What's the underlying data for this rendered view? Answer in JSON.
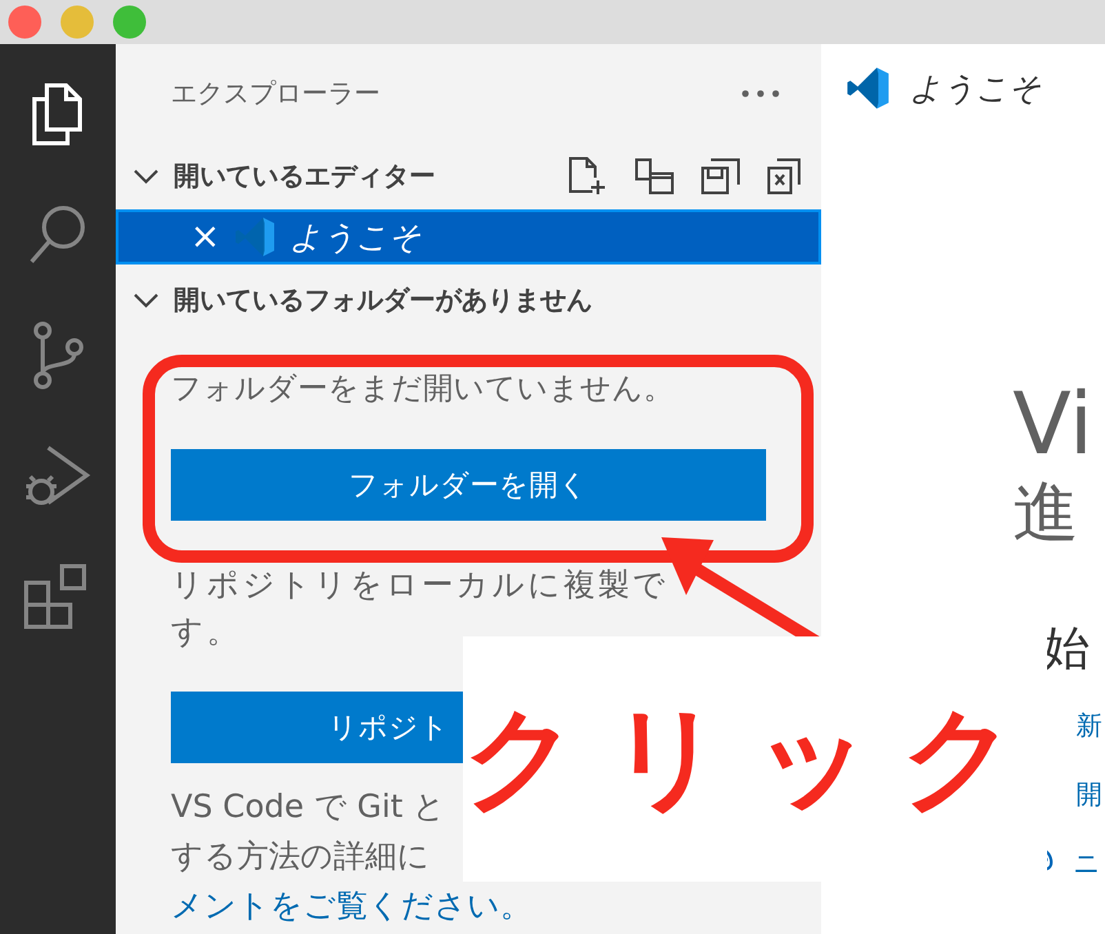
{
  "window": {
    "traffic_lights": [
      {
        "color": "#fe5f57"
      },
      {
        "color": "#e5bd3a"
      },
      {
        "color": "#3fbe3a"
      }
    ]
  },
  "activity_bar": {
    "items": [
      {
        "kind": "files",
        "selected": true
      },
      {
        "kind": "search",
        "selected": false
      },
      {
        "kind": "source-control",
        "selected": false
      },
      {
        "kind": "run-debug",
        "selected": false
      },
      {
        "kind": "extensions",
        "selected": false
      }
    ]
  },
  "sidebar": {
    "title": "エクスプローラー",
    "open_editors": {
      "title": "開いているエディター",
      "expanded": true,
      "actions": [
        {
          "kind": "new-file"
        },
        {
          "kind": "new-window"
        },
        {
          "kind": "save-all"
        },
        {
          "kind": "close-all"
        }
      ],
      "items": [
        {
          "name": "ようこそ",
          "close": "×",
          "selected": true
        }
      ]
    },
    "folder_section": {
      "title": "開いているフォルダーがありません",
      "expanded": true,
      "message": "フォルダーをまだ開いていません。",
      "open_button": "フォルダーを開く",
      "clone_text": [
        "リポジトリをローカルに複製で",
        "す。"
      ],
      "clone_button": "リポジト",
      "git_lines": [
        "VS Code で Git と",
        "する方法の詳細に"
      ],
      "docs_link": "メントをご覧ください。"
    }
  },
  "editor": {
    "tabs": [
      {
        "label": "ようこそ",
        "selected": true
      }
    ],
    "heading": "Vi",
    "subtitle": "進",
    "start_heading": "始",
    "start_links": [
      {
        "kind": "blank",
        "label": "新"
      },
      {
        "kind": "blank",
        "label": "開"
      },
      {
        "kind": "palette",
        "label": "ニ"
      }
    ]
  },
  "annotation": {
    "label": "クリック"
  }
}
